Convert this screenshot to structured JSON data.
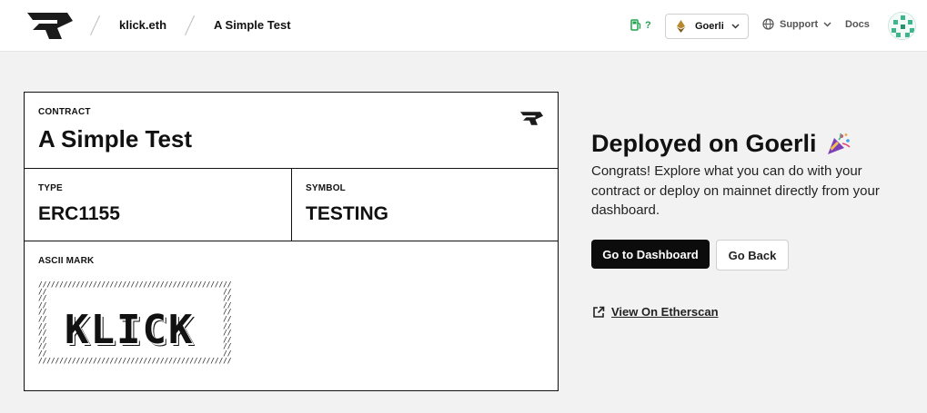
{
  "header": {
    "breadcrumb": [
      "klick.eth",
      "A Simple Test"
    ],
    "gas_label": "?",
    "network": "Goerli",
    "support_label": "Support",
    "docs_label": "Docs"
  },
  "card": {
    "contract_label": "CONTRACT",
    "contract_name": "A Simple Test",
    "type_label": "TYPE",
    "type_value": "ERC1155",
    "symbol_label": "SYMBOL",
    "symbol_value": "TESTING",
    "ascii_label": "ASCII MARK",
    "ascii_art": "//////////////////////////////////////////////\n//                                          //\n//                                          //\n//                                          //\n//                                          //\n//                                          //\n//                                          //\n//                                          //\n//                                          //\n//                                          //\n//                                          //\n//////////////////////////////////////////////",
    "ascii_word": "KLICK"
  },
  "panel": {
    "title": "Deployed on Goerli",
    "description": "Congrats! Explore what you can do with your contract or deploy on mainnet directly from your dashboard.",
    "primary_button": "Go to Dashboard",
    "secondary_button": "Go Back",
    "link_label": "View On Etherscan"
  },
  "colors": {
    "accent": "#0c0c0c",
    "gas_green": "#22a24c",
    "background": "#f2f2f2"
  }
}
